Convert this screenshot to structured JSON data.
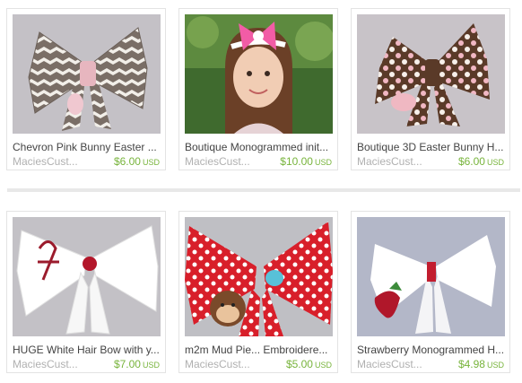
{
  "listings": [
    {
      "title": "Chevron Pink Bunny Easter ...",
      "shop": "MaciesCust...",
      "price": "$6.00",
      "currency": "USD",
      "image": "chevron-bow-image"
    },
    {
      "title": "Boutique Monogrammed init...",
      "shop": "MaciesCust...",
      "price": "$10.00",
      "currency": "USD",
      "image": "girl-with-pink-bow-image"
    },
    {
      "title": "Boutique 3D Easter Bunny H...",
      "shop": "MaciesCust...",
      "price": "$6.00",
      "currency": "USD",
      "image": "brown-polka-dot-bow-image"
    },
    {
      "title": "HUGE White Hair Bow with y...",
      "shop": "MaciesCust...",
      "price": "$7.00",
      "currency": "USD",
      "image": "white-monogram-bow-image"
    },
    {
      "title": "m2m Mud Pie... Embroidere...",
      "shop": "MaciesCust...",
      "price": "$5.00",
      "currency": "USD",
      "image": "red-polka-dot-monkey-bow-image"
    },
    {
      "title": "Strawberry Monogrammed H...",
      "shop": "MaciesCust...",
      "price": "$4.98",
      "currency": "USD",
      "image": "white-strawberry-bow-image"
    }
  ],
  "colors": {
    "price": "#78b43c",
    "shop": "#b0b0b0",
    "title": "#444444",
    "border": "#e3e3e3"
  }
}
